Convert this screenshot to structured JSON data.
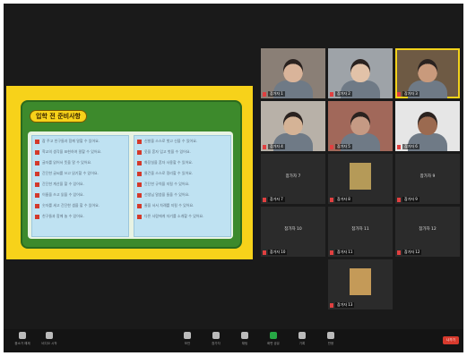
{
  "share": {
    "title": "입학 전 준비사항",
    "left_items": [
      "잠 주고 친구들과 함께 말할 수 있어요.",
      "학교의 생각을 표현하여 말할 수 있어요.",
      "글자를 읽어서 뜻을 알 수 있어요.",
      "간단한 글씨를 쓰고 읽기할 수 있어요.",
      "간단한 계산을 할 수 있어요.",
      "이름을 쓰고 읽을 수 있어요.",
      "숫자를 세고 간단한 셈을 할 수 있어요.",
      "친구들과 함께 놀 수 있어요."
    ],
    "right_items": [
      "신발을 스스로 벗고 신을 수 있어요.",
      "옷을 혼자 입고 벗을 수 있어요.",
      "화장실을 혼자 사용할 수 있어요.",
      "물건을 스스로 정리할 수 있어요.",
      "간단한 규칙을 지킬 수 있어요.",
      "선생님 말씀을 들을 수 있어요.",
      "줄을 서서 차례를 지킬 수 있어요.",
      "다른 사람에게 자기를 소개할 수 있어요."
    ]
  },
  "participants": [
    {
      "name": "참가자 1",
      "kind": "video",
      "skin": "#d9b49a",
      "bg": "#8a7f76"
    },
    {
      "name": "참가자 2",
      "kind": "video",
      "skin": "#e2c2a8",
      "bg": "#9ea3a8"
    },
    {
      "name": "참가자 3",
      "kind": "video",
      "skin": "#c99a7c",
      "bg": "#6e5a44",
      "active": true
    },
    {
      "name": "참가자 4",
      "kind": "video",
      "skin": "#d5b396",
      "bg": "#b8b1a8"
    },
    {
      "name": "참가자 5",
      "kind": "video",
      "skin": "#c59a84",
      "bg": "#a1685a"
    },
    {
      "name": "참가자 6",
      "kind": "video",
      "skin": "#9b6a50",
      "bg": "#e6e6e6"
    },
    {
      "name": "참가자 7",
      "kind": "name",
      "label": "참가자 7"
    },
    {
      "name": "참가자 8",
      "kind": "image",
      "thumb": "#b59a58"
    },
    {
      "name": "참가자 9",
      "kind": "name",
      "label": "참가자 9"
    },
    {
      "name": "참가자 10",
      "kind": "name",
      "label": "참가자 10"
    },
    {
      "name": "참가자 11",
      "kind": "name",
      "label": "참가자 11"
    },
    {
      "name": "참가자 12",
      "kind": "name",
      "label": "참가자 12"
    },
    {
      "name": "참가자 13",
      "kind": "image",
      "thumb": "#c49a58"
    }
  ],
  "toolbar": {
    "buttons": [
      {
        "label": "음소거 해제",
        "icon": "mic-off-icon"
      },
      {
        "label": "비디오 시작",
        "icon": "video-icon"
      },
      {
        "label": "보안",
        "icon": "shield-icon"
      },
      {
        "label": "참가자",
        "icon": "participants-icon"
      },
      {
        "label": "채팅",
        "icon": "chat-icon"
      },
      {
        "label": "화면 공유",
        "icon": "share-screen-icon",
        "accent": "#27a845"
      },
      {
        "label": "기록",
        "icon": "record-icon"
      },
      {
        "label": "반응",
        "icon": "reactions-icon"
      }
    ],
    "end_label": "나가기"
  }
}
